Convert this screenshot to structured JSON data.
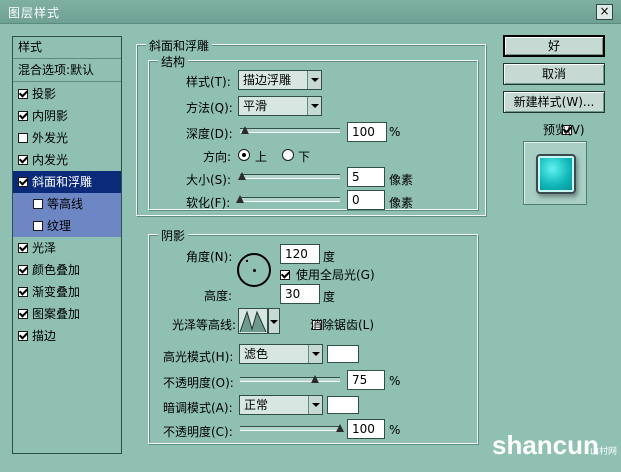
{
  "window": {
    "title": "图层样式",
    "close_glyph": "×"
  },
  "style_list": {
    "header": "样式",
    "blend_options": "混合选项:默认",
    "items": [
      {
        "label": "投影",
        "checked": true
      },
      {
        "label": "内阴影",
        "checked": true
      },
      {
        "label": "外发光",
        "checked": false
      },
      {
        "label": "内发光",
        "checked": true
      },
      {
        "label": "斜面和浮雕",
        "checked": true,
        "selected": true
      },
      {
        "label": "等高线",
        "checked": false,
        "sub": true
      },
      {
        "label": "纹理",
        "checked": false,
        "sub": true
      },
      {
        "label": "光泽",
        "checked": true
      },
      {
        "label": "颜色叠加",
        "checked": true
      },
      {
        "label": "渐变叠加",
        "checked": true
      },
      {
        "label": "图案叠加",
        "checked": true
      },
      {
        "label": "描边",
        "checked": true
      }
    ]
  },
  "bevel": {
    "group_title": "斜面和浮雕",
    "structure_title": "结构",
    "style_label": "样式(T):",
    "style_value": "描边浮雕",
    "technique_label": "方法(Q):",
    "technique_value": "平滑",
    "depth_label": "深度(D):",
    "depth_value": "100",
    "depth_unit": "%",
    "depth_level": 0.05,
    "direction_label": "方向:",
    "direction_up": "上",
    "direction_down": "下",
    "size_label": "大小(S):",
    "size_value": "5",
    "size_unit": "像素",
    "size_level": 0.02,
    "soften_label": "软化(F):",
    "soften_value": "0",
    "soften_unit": "像素",
    "soften_level": 0.0
  },
  "shading": {
    "title": "阴影",
    "angle_label": "角度(N):",
    "angle_value": "120",
    "angle_unit": "度",
    "global_light_label": "使用全局光(G)",
    "global_light_checked": true,
    "altitude_label": "高度:",
    "altitude_value": "30",
    "altitude_unit": "度",
    "gloss_label": "光泽等高线:",
    "antialias_label": "消除锯齿(L)",
    "antialias_checked": false,
    "highlight_mode_label": "高光模式(H):",
    "highlight_mode_value": "滤色",
    "highlight_color": "#ffffff",
    "highlight_opacity_label": "不透明度(O):",
    "highlight_opacity_value": "75",
    "highlight_opacity_unit": "%",
    "highlight_opacity_level": 0.75,
    "shadow_mode_label": "暗调模式(A):",
    "shadow_mode_value": "正常",
    "shadow_color": "#ffffff",
    "shadow_opacity_label": "不透明度(C):",
    "shadow_opacity_value": "100",
    "shadow_opacity_unit": "%",
    "shadow_opacity_level": 1.0
  },
  "buttons": {
    "ok": "好",
    "cancel": "取消",
    "new_style": "新建样式(W)...",
    "preview_label": "预览(V)",
    "preview_checked": true
  },
  "watermark": {
    "text": "shancun",
    "sub": "山村网"
  },
  "colors": {
    "background": "#8fc0b2",
    "selection": "#0a2a7a",
    "sub_item": "#6d86c4"
  }
}
